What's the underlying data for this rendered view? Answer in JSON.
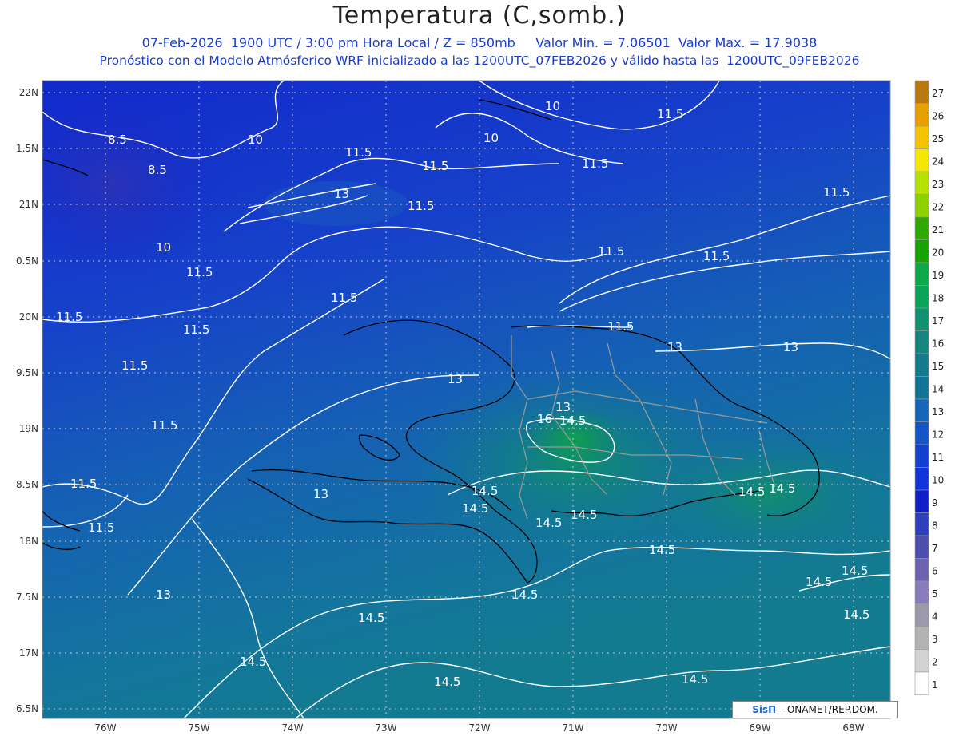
{
  "header": {
    "title": "Temperatura (C,somb.)",
    "line1": "07-Feb-2026  1900 UTC / 3:00 pm Hora Local / Z = 850mb     Valor Min. = 7.06501  Valor Max. = 17.9038",
    "line2": "Pronóstico con el Modelo Atmósferico WRF inicializado a las 1200UTC_07FEB2026 y válido hasta las  1200UTC_09FEB2026"
  },
  "lat_labels": [
    "22N",
    "1.5N",
    "21N",
    "0.5N",
    "20N",
    "9.5N",
    "19N",
    "8.5N",
    "18N",
    "7.5N",
    "17N",
    "6.5N"
  ],
  "lon_labels": [
    "76W",
    "75W",
    "74W",
    "73W",
    "72W",
    "71W",
    "70W",
    "69W",
    "68W"
  ],
  "colorbar": {
    "labels": [
      "27",
      "26",
      "25",
      "24",
      "23",
      "22",
      "21",
      "20",
      "19",
      "18",
      "17",
      "16",
      "15",
      "14",
      "13",
      "12",
      "11",
      "10",
      "9",
      "8",
      "7",
      "6",
      "5",
      "4",
      "3",
      "2",
      "1"
    ],
    "colors": [
      "#b8790e",
      "#e6a000",
      "#f5c400",
      "#f5e800",
      "#b5e000",
      "#8fd000",
      "#2fa800",
      "#16a400",
      "#0ea84a",
      "#0ca35a",
      "#109270",
      "#14857f",
      "#137b8b",
      "#127399",
      "#1367b6",
      "#1454c6",
      "#1341cf",
      "#1133d9",
      "#0f1fc8",
      "#2d3fbc",
      "#4e4ead",
      "#6b63b0",
      "#8a7bbc",
      "#9a9aa8",
      "#b3b3b3",
      "#d3d3d3",
      "#ffffff"
    ]
  },
  "contour_labels": [
    {
      "text": "8.5"
    },
    {
      "text": "8.5"
    },
    {
      "text": "10"
    },
    {
      "text": "10"
    },
    {
      "text": "10"
    },
    {
      "text": "10"
    },
    {
      "text": "11.5"
    },
    {
      "text": "11.5"
    },
    {
      "text": "11.5"
    },
    {
      "text": "11.5"
    },
    {
      "text": "11.5"
    },
    {
      "text": "11.5"
    },
    {
      "text": "11.5"
    },
    {
      "text": "11.5"
    },
    {
      "text": "11.5"
    },
    {
      "text": "11.5"
    },
    {
      "text": "11.5"
    },
    {
      "text": "11.5"
    },
    {
      "text": "11.5"
    },
    {
      "text": "11.5"
    },
    {
      "text": "11.5"
    },
    {
      "text": "11.5"
    },
    {
      "text": "11.5"
    },
    {
      "text": "13"
    },
    {
      "text": "13"
    },
    {
      "text": "13"
    },
    {
      "text": "13"
    },
    {
      "text": "13"
    },
    {
      "text": "13"
    },
    {
      "text": "13"
    },
    {
      "text": "16"
    },
    {
      "text": "14.5"
    },
    {
      "text": "14.5"
    },
    {
      "text": "14.5"
    },
    {
      "text": "14.5"
    },
    {
      "text": "14.5"
    },
    {
      "text": "14.5"
    },
    {
      "text": "14.5"
    },
    {
      "text": "14.5"
    },
    {
      "text": "14.5"
    },
    {
      "text": "14.5"
    },
    {
      "text": "14.5"
    },
    {
      "text": "14.5"
    },
    {
      "text": "14.5"
    },
    {
      "text": "14.5"
    },
    {
      "text": "14.5"
    },
    {
      "text": "14.5"
    }
  ],
  "credit": {
    "brand": "SisΠ",
    "text": "– ONAMET/REP.DOM."
  }
}
